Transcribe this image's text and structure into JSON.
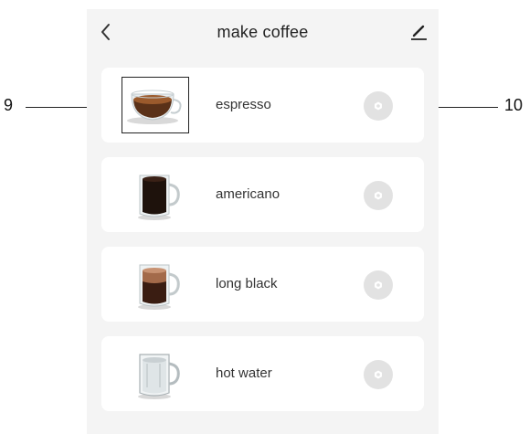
{
  "header": {
    "title": "make coffee",
    "back_icon": "chevron-left-icon",
    "edit_icon": "edit-pencil-icon"
  },
  "drinks": [
    {
      "label": "espresso",
      "icon": "espresso-glass-icon"
    },
    {
      "label": "americano",
      "icon": "americano-mug-icon"
    },
    {
      "label": "long black",
      "icon": "long-black-mug-icon"
    },
    {
      "label": "hot water",
      "icon": "hot-water-mug-icon"
    }
  ],
  "callouts": {
    "left": "9",
    "right": "10"
  },
  "colors": {
    "background": "#f4f4f4",
    "card": "#ffffff",
    "settings_button": "#e2e2e2"
  }
}
